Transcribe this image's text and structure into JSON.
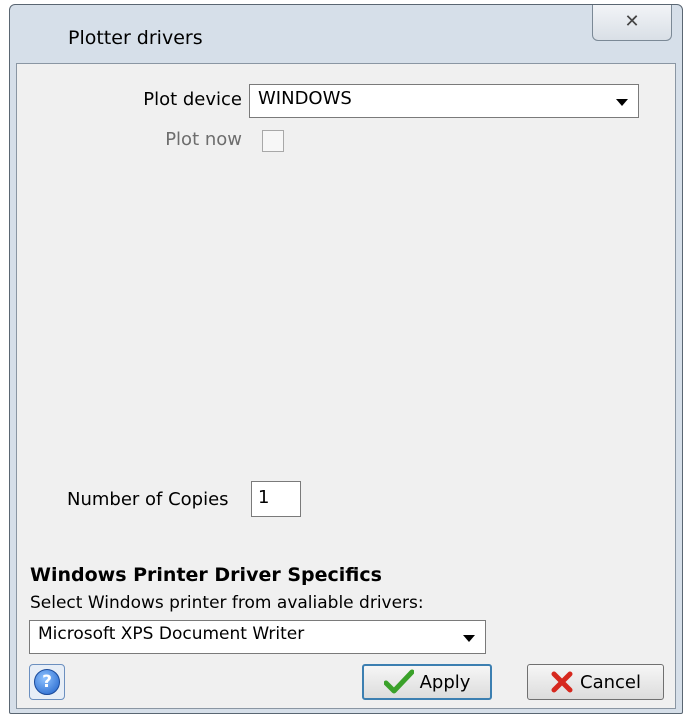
{
  "window": {
    "title": "Plotter drivers",
    "close_glyph": "✕"
  },
  "plot_device": {
    "label": "Plot device",
    "value": "WINDOWS"
  },
  "plot_now": {
    "label": "Plot now",
    "checked": false
  },
  "copies": {
    "label": "Number of Copies",
    "value": "1"
  },
  "windows_section": {
    "title": "Windows Printer Driver Specifics",
    "hint": "Select Windows printer from avaliable drivers:",
    "printer_value": "Microsoft XPS Document Writer"
  },
  "buttons": {
    "help_glyph": "?",
    "apply_label": "Apply",
    "cancel_label": "Cancel"
  },
  "icons": {
    "help": "help-icon",
    "apply": "checkmark-icon",
    "cancel": "cross-icon",
    "dropdown": "chevron-down-icon",
    "close": "close-icon"
  },
  "colors": {
    "frame": "#d6dfe9",
    "client": "#f0f0f0",
    "disabled_text": "#6d6d6d",
    "apply_border": "#3c7fb1",
    "check_green": "#3aa12a",
    "cancel_red": "#d6281e"
  }
}
